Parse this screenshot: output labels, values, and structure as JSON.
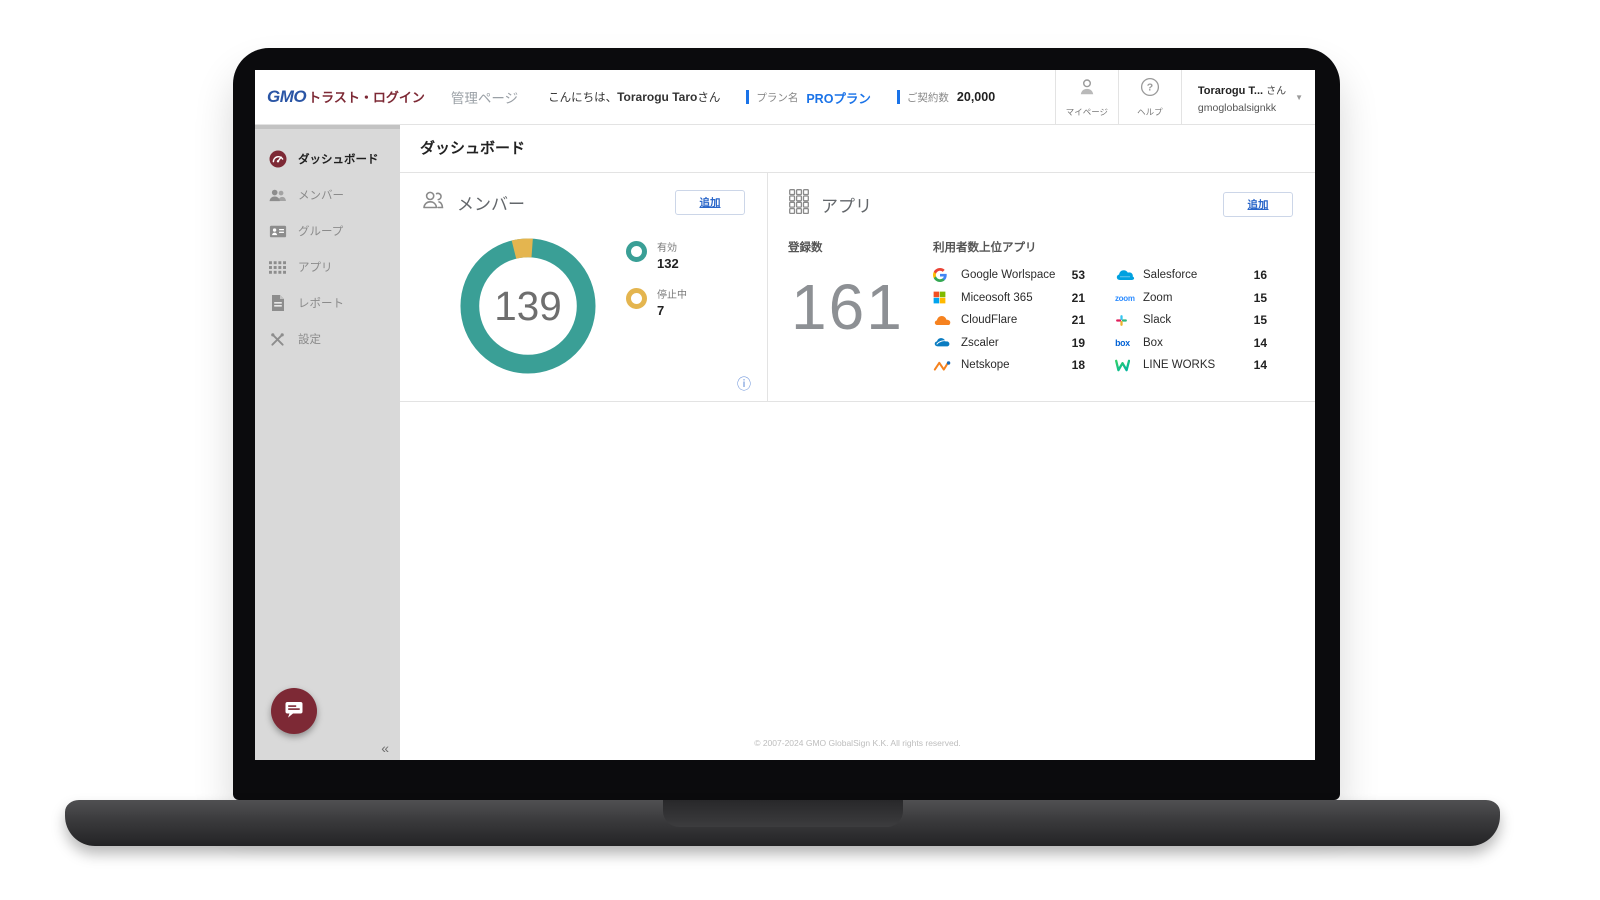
{
  "colors": {
    "teal": "#3a9f96",
    "gold": "#e4b54f",
    "maroon": "#7d2935",
    "accent-blue": "#2a66c9",
    "plan-blue": "#1a73e8",
    "logo-blue": "#2a55a5"
  },
  "header": {
    "logo_gmo": "GMO",
    "logo_jp": "トラスト・ログイン",
    "admin_label": "管理ページ",
    "greeting_prefix": "こんにちは、",
    "greeting_name": "Torarogu Taro",
    "greeting_suffix": "さん",
    "plan_label": "プラン名",
    "plan_value": "PROプラン",
    "contract_label": "ご契約数",
    "contract_value": "20,000",
    "mypage_label": "マイページ",
    "help_label": "ヘルプ",
    "account_name": "Torarogu T...",
    "account_honorific": "さん",
    "account_id": "gmoglobalsignkk",
    "caret_glyph": "▼"
  },
  "sidebar": {
    "items": [
      {
        "label": "ダッシュボード",
        "active": true
      },
      {
        "label": "メンバー",
        "active": false
      },
      {
        "label": "グループ",
        "active": false
      },
      {
        "label": "アプリ",
        "active": false
      },
      {
        "label": "レポート",
        "active": false
      },
      {
        "label": "設定",
        "active": false
      }
    ],
    "collapse_glyph": "«"
  },
  "page": {
    "title": "ダッシュボード"
  },
  "member_card": {
    "title": "メンバー",
    "add_label": "追加",
    "total": "139",
    "legend": [
      {
        "label": "有効",
        "value": "132"
      },
      {
        "label": "停止中",
        "value": "7"
      }
    ],
    "info_glyph": "ⓘ"
  },
  "app_card": {
    "title": "アプリ",
    "add_label": "追加",
    "registered_label": "登録数",
    "registered_value": "161",
    "top_label": "利用者数上位アプリ",
    "columns": [
      {
        "apps": [
          {
            "icon": "google-icon",
            "name": "Google Worlspace",
            "count": "53"
          },
          {
            "icon": "microsoft-icon",
            "name": "Miceosoft 365",
            "count": "21"
          },
          {
            "icon": "cloudflare-icon",
            "name": "CloudFlare",
            "count": "21"
          },
          {
            "icon": "zscaler-icon",
            "name": "Zscaler",
            "count": "19"
          },
          {
            "icon": "netskope-icon",
            "name": "Netskope",
            "count": "18"
          }
        ]
      },
      {
        "apps": [
          {
            "icon": "salesforce-icon",
            "name": "Salesforce",
            "count": "16"
          },
          {
            "icon": "zoom-icon",
            "name": "Zoom",
            "count": "15"
          },
          {
            "icon": "slack-icon",
            "name": "Slack",
            "count": "15"
          },
          {
            "icon": "box-icon",
            "name": "Box",
            "count": "14"
          },
          {
            "icon": "lineworks-icon",
            "name": "LINE WORKS",
            "count": "14"
          }
        ]
      }
    ]
  },
  "chart_data": {
    "type": "pie",
    "title": "メンバー",
    "categories": [
      "有効",
      "停止中"
    ],
    "values": [
      132,
      7
    ],
    "total": 139,
    "colors": [
      "#3a9f96",
      "#e4b54f"
    ],
    "legend_position": "right"
  },
  "footer": {
    "copyright": "© 2007-2024 GMO GlobalSign K.K. All rights reserved."
  }
}
